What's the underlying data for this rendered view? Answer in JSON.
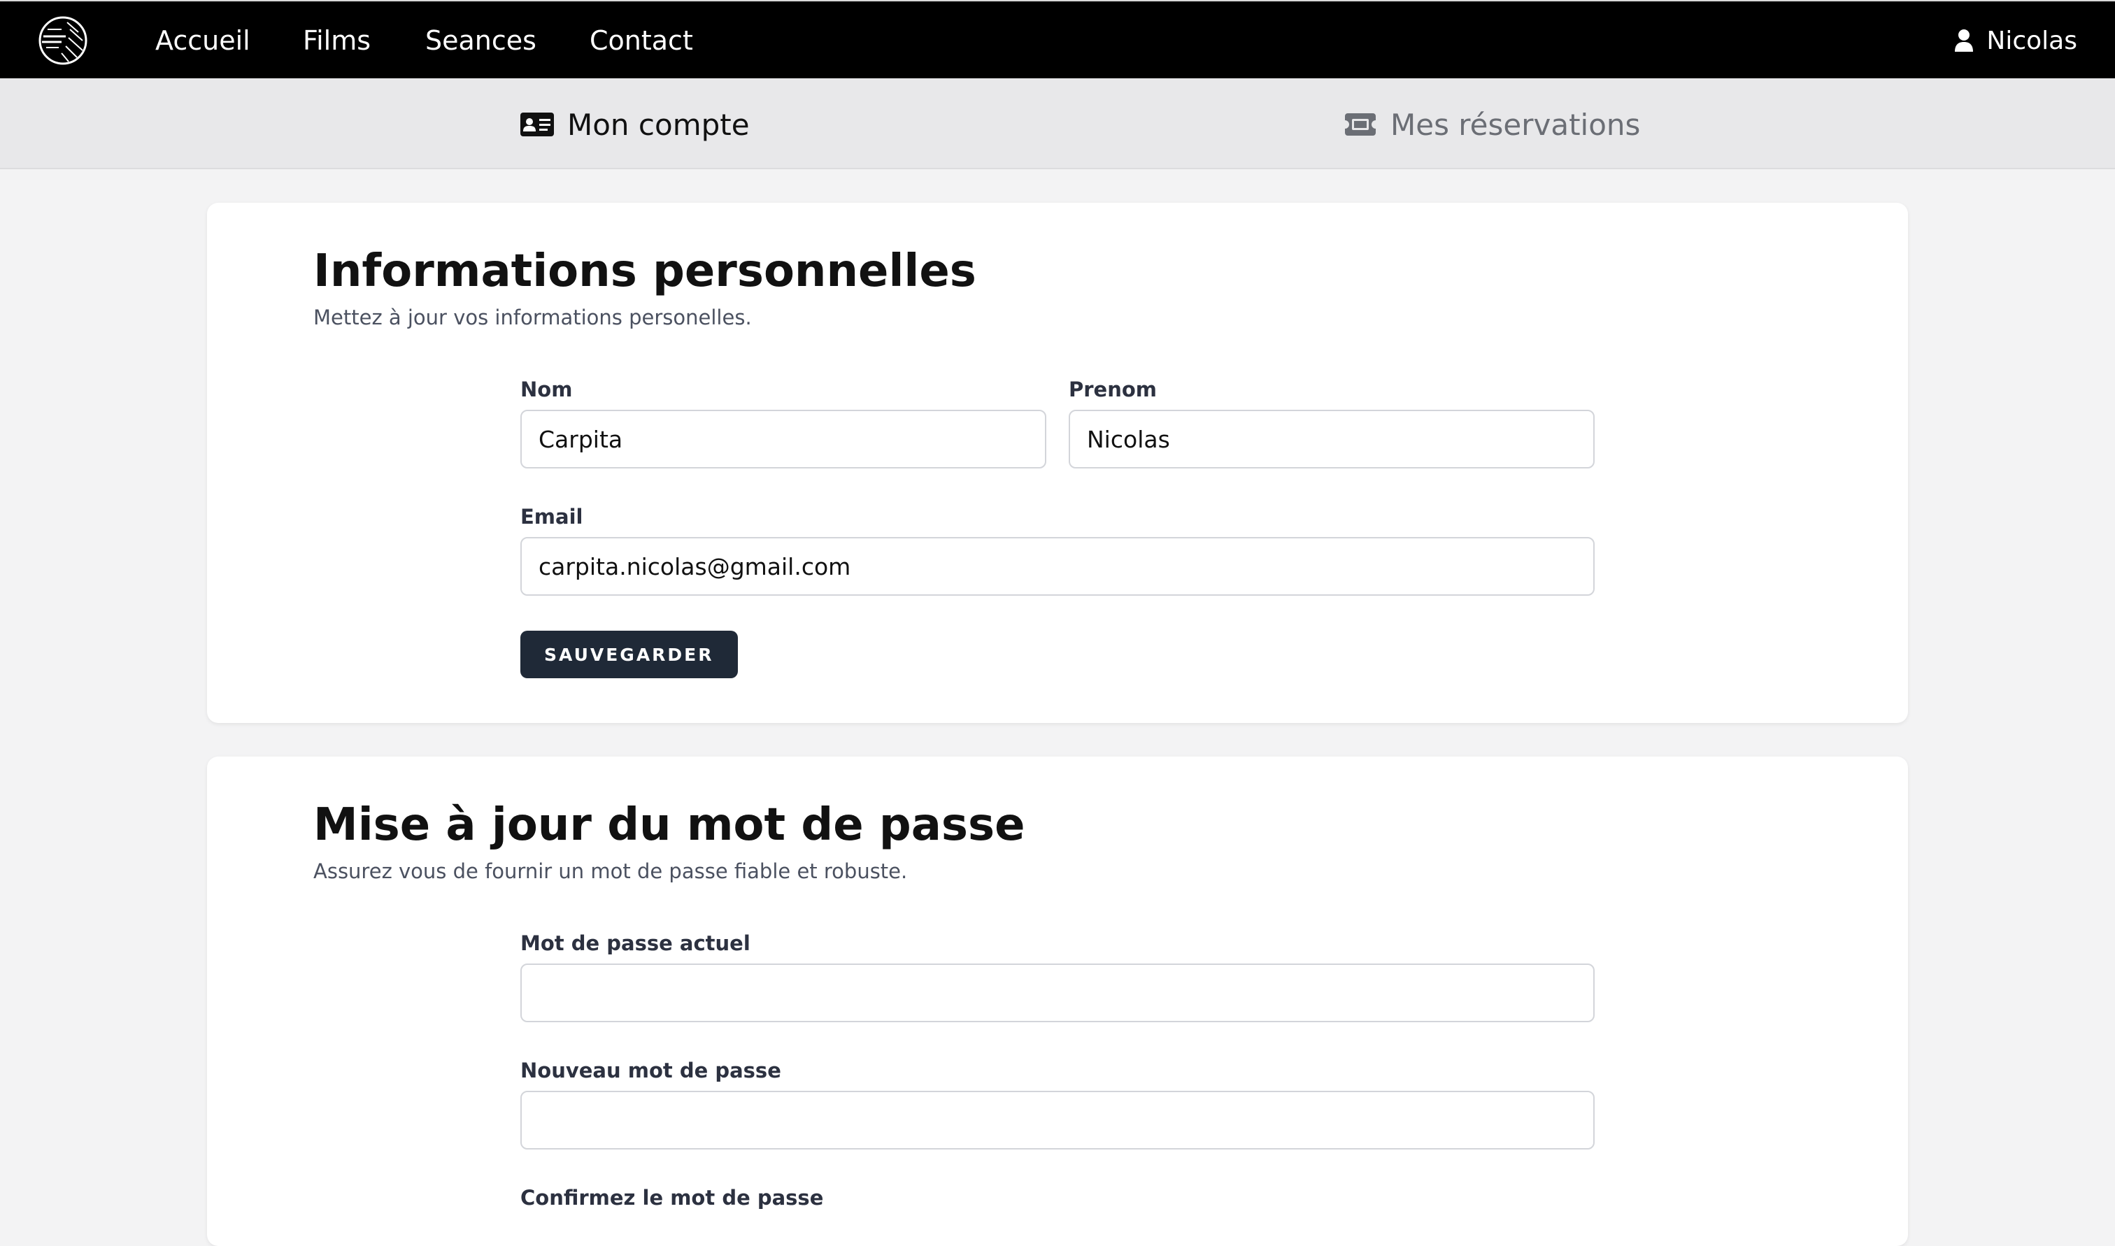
{
  "nav": {
    "links": [
      "Accueil",
      "Films",
      "Seances",
      "Contact"
    ],
    "user_name": "Nicolas"
  },
  "tabs": [
    {
      "label": "Mon compte",
      "icon": "id-card-icon",
      "active": true
    },
    {
      "label": "Mes réservations",
      "icon": "ticket-icon",
      "active": false
    }
  ],
  "profile": {
    "title": "Informations personnelles",
    "description": "Mettez à jour vos informations personelles.",
    "nom_label": "Nom",
    "nom_value": "Carpita",
    "prenom_label": "Prenom",
    "prenom_value": "Nicolas",
    "email_label": "Email",
    "email_value": "carpita.nicolas@gmail.com",
    "save_label": "SAUVEGARDER"
  },
  "password": {
    "title": "Mise à jour du mot de passe",
    "description": "Assurez vous de fournir un mot de passe fiable et robuste.",
    "current_label": "Mot de passe actuel",
    "new_label": "Nouveau mot de passe",
    "confirm_label": "Confirmez le mot de passe"
  },
  "colors": {
    "nav_bg": "#000000",
    "button_bg": "#1f2937",
    "page_bg": "#f3f3f4"
  }
}
